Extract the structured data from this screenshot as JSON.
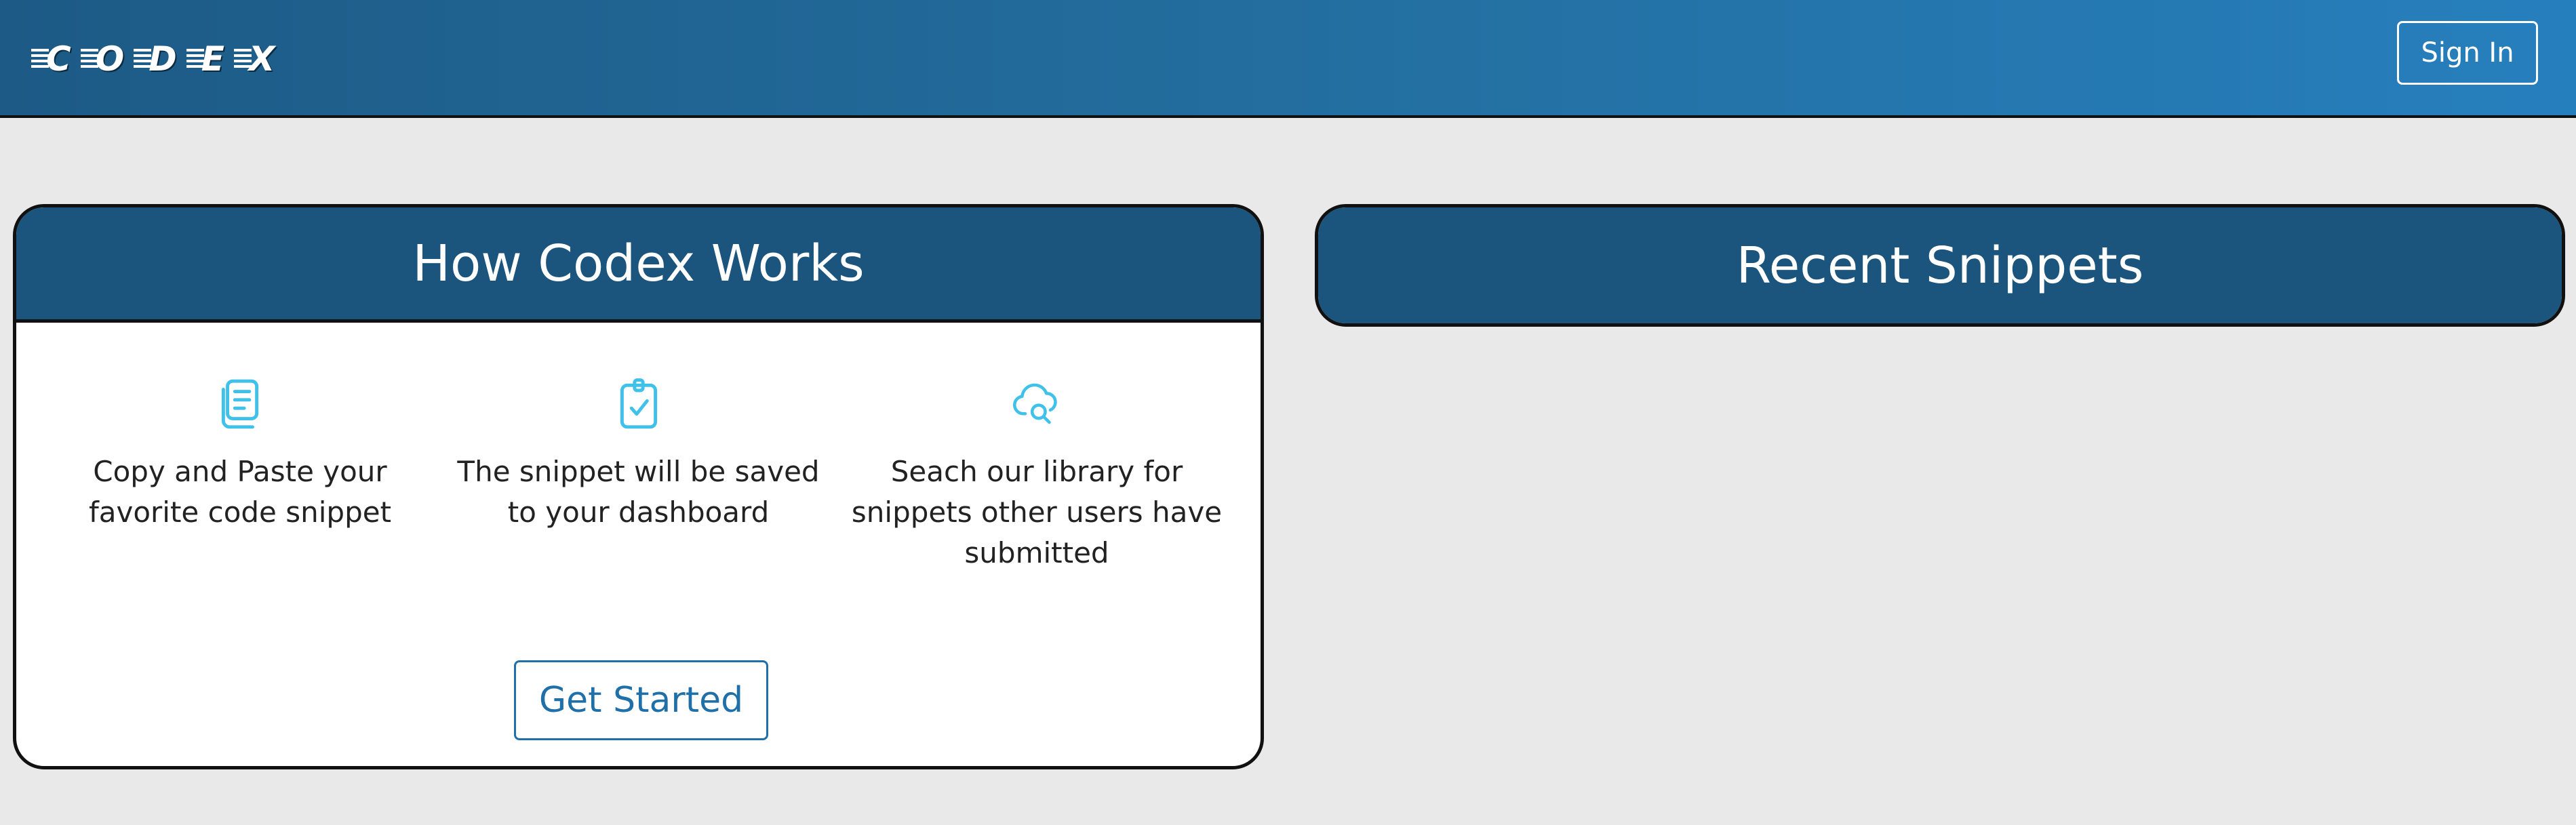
{
  "navbar": {
    "logo_letters": [
      "C",
      "O",
      "D",
      "E",
      "X"
    ],
    "signin_label": "Sign In"
  },
  "how_it_works": {
    "title": "How Codex Works",
    "steps": [
      {
        "icon": "copy-document-icon",
        "text": "Copy and Paste your favorite code snippet"
      },
      {
        "icon": "clipboard-check-icon",
        "text": "The snippet will be saved to your dashboard"
      },
      {
        "icon": "cloud-search-icon",
        "text": "Seach our library for snippets other users have submitted"
      }
    ],
    "cta_label": "Get Started"
  },
  "recent_snippets": {
    "title": "Recent Snippets"
  },
  "colors": {
    "header_dark": "#1b547c",
    "nav_gradient_start": "#1d5a86",
    "nav_gradient_end": "#267fbd",
    "icon_accent": "#3fc1ea",
    "button_blue": "#1f6fa8",
    "page_bg": "#e9e9e9"
  }
}
